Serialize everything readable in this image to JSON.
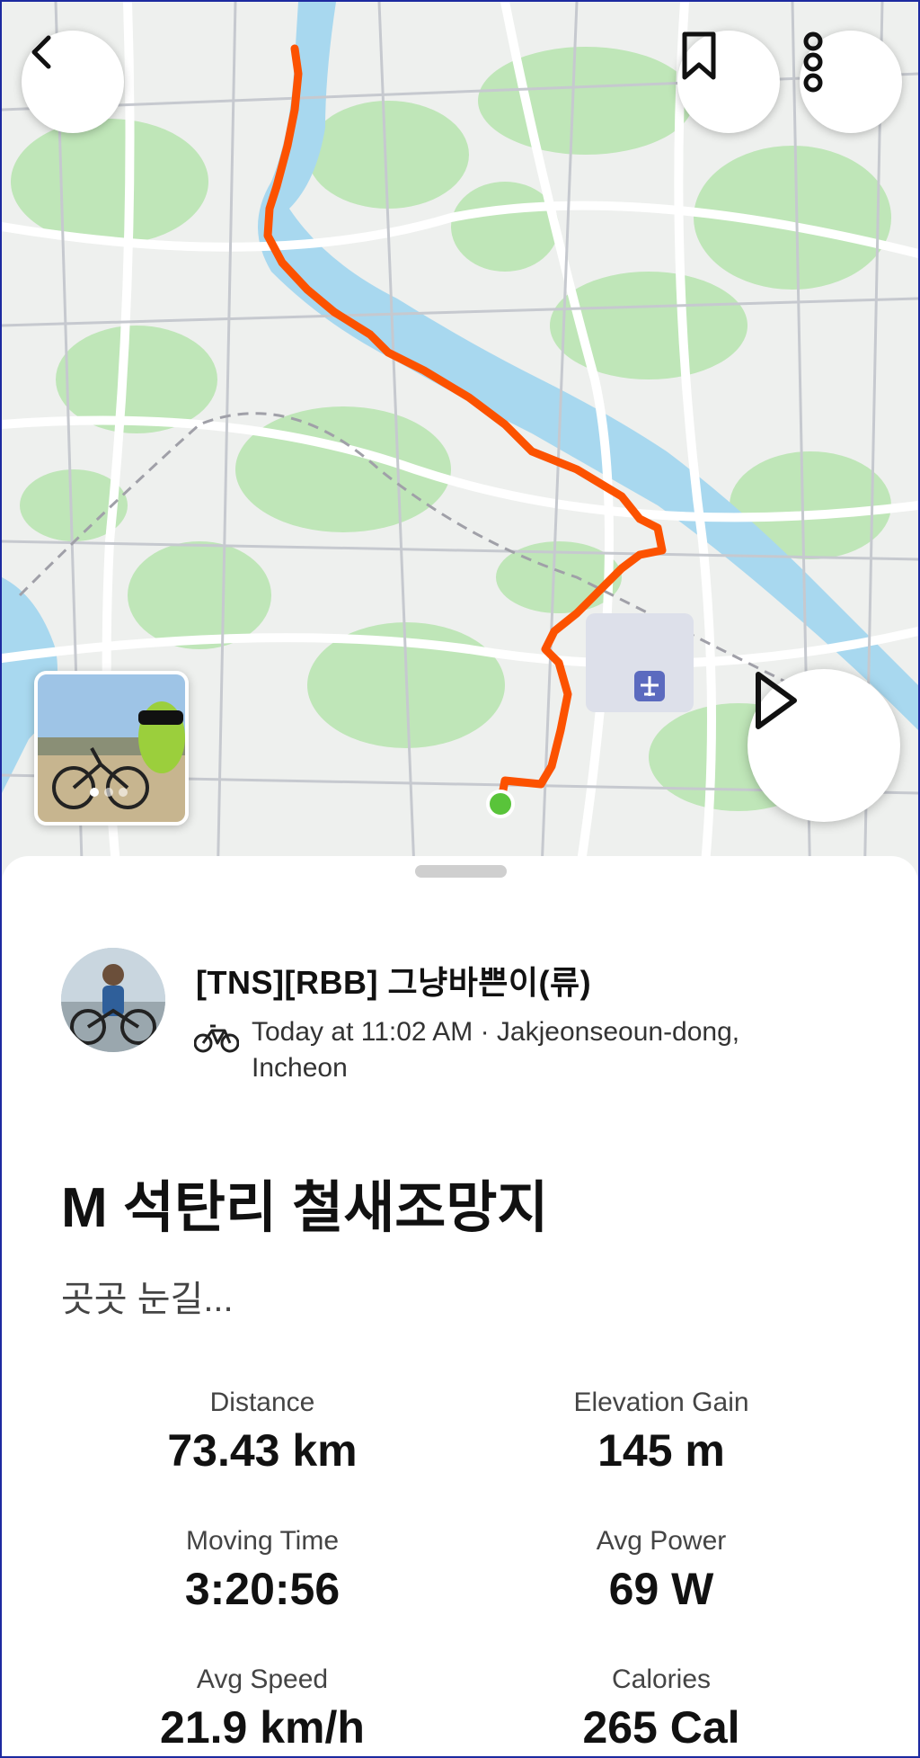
{
  "map": {
    "icons": [
      "back-icon",
      "bookmark-icon",
      "more-icon",
      "play-icon",
      "airport-icon",
      "start-marker-icon"
    ],
    "route_color": "#fc5200",
    "start_color": "#59c43a",
    "water_color": "#a8d8ef",
    "park_color": "#bfe6b8"
  },
  "athlete": {
    "name": "[TNS][RBB] 그냥바쁜이(류)",
    "activity_meta": "Today at 11:02 AM · Jakjeonseoun-dong, Incheon",
    "activity_type_icon": "bike-icon"
  },
  "activity": {
    "title": "M 석탄리 철새조망지",
    "description": "곳곳 눈길..."
  },
  "stats": [
    {
      "label": "Distance",
      "value": "73.43 km"
    },
    {
      "label": "Elevation Gain",
      "value": "145 m"
    },
    {
      "label": "Moving Time",
      "value": "3:20:56"
    },
    {
      "label": "Avg Power",
      "value": "69 W"
    },
    {
      "label": "Avg Speed",
      "value": "21.9 km/h"
    },
    {
      "label": "Calories",
      "value": "265 Cal"
    }
  ]
}
